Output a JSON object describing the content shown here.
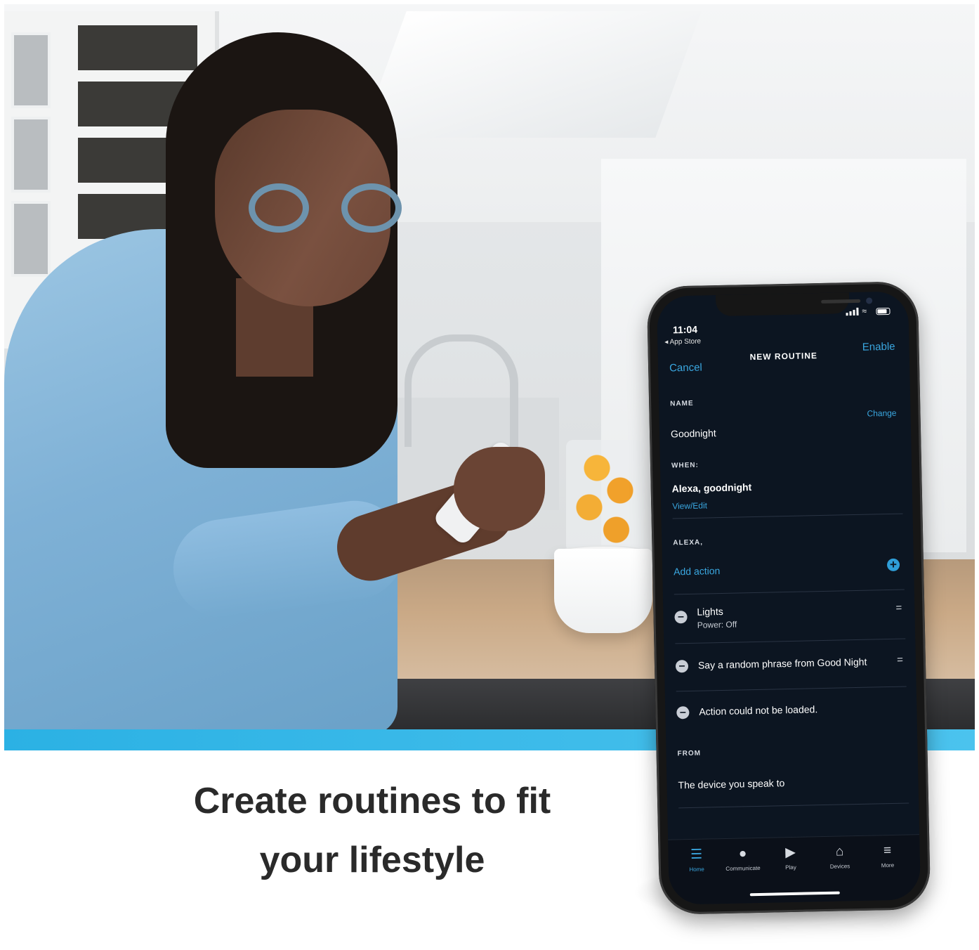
{
  "caption": {
    "line1": "Create routines to fit",
    "line2": "your lifestyle"
  },
  "phone": {
    "status_bar": {
      "time": "11:04",
      "back_label": "◂ App Store",
      "icons": [
        "signal-icon",
        "wifi-icon",
        "battery-icon"
      ]
    },
    "nav": {
      "cancel_label": "Cancel",
      "title": "NEW ROUTINE",
      "enable_label": "Enable"
    },
    "name_section": {
      "label": "NAME",
      "value": "Goodnight",
      "change_label": "Change"
    },
    "when_section": {
      "label": "WHEN:",
      "value": "Alexa, goodnight",
      "view_edit_label": "View/Edit"
    },
    "alexa_section": {
      "label": "ALEXA,",
      "add_action_label": "Add action",
      "actions": [
        {
          "title": "Lights",
          "subtitle": "Power: Off"
        },
        {
          "title": "Say a random phrase from Good Night",
          "subtitle": ""
        },
        {
          "title": "Action could not be loaded.",
          "subtitle": ""
        }
      ]
    },
    "from_section": {
      "label": "FROM",
      "value": "The device you speak to"
    },
    "tabbar": {
      "items": [
        {
          "label": "Home",
          "icon": "home-icon",
          "active": true
        },
        {
          "label": "Communicate",
          "icon": "chat-icon",
          "active": false
        },
        {
          "label": "Play",
          "icon": "play-icon",
          "active": false
        },
        {
          "label": "Devices",
          "icon": "devices-icon",
          "active": false
        },
        {
          "label": "More",
          "icon": "menu-icon",
          "active": false
        }
      ]
    }
  },
  "colors": {
    "accent": "#3aa7e0",
    "band": "#2bb1e4",
    "screen_bg": "#0c1521",
    "caption_text": "#2a2a2a"
  }
}
